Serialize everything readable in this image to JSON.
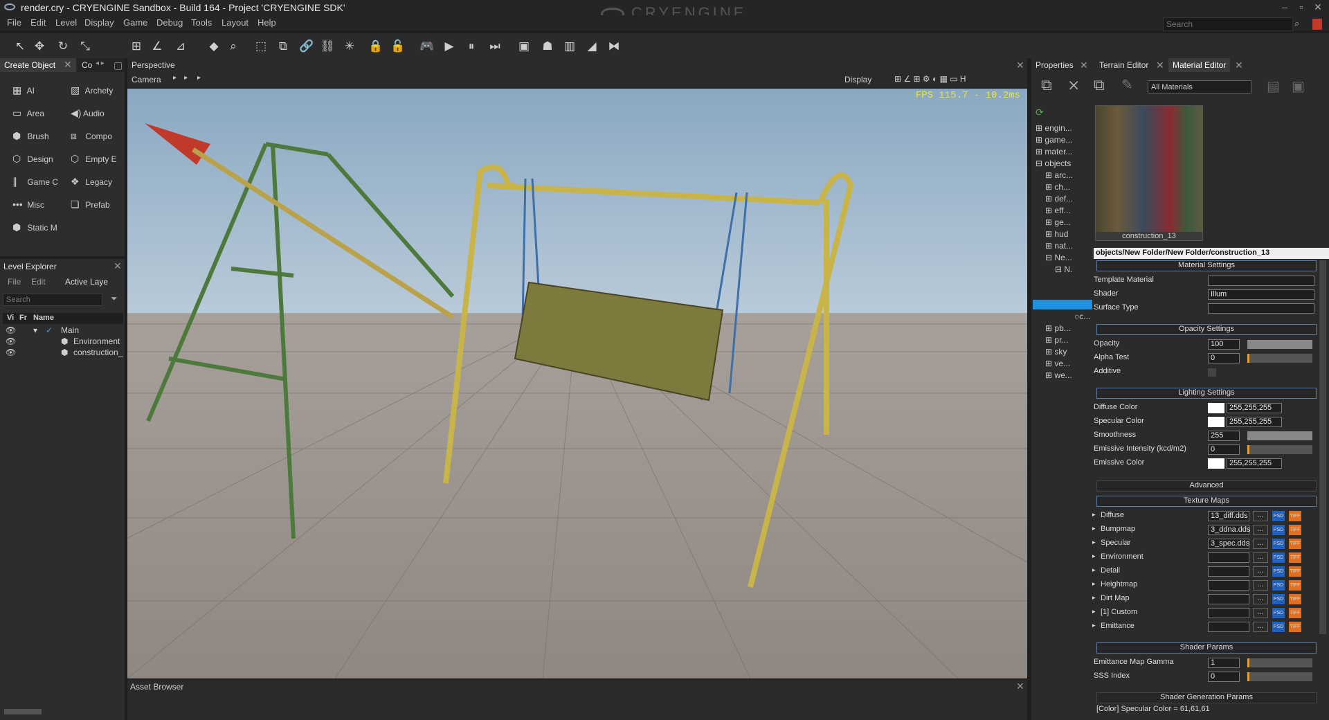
{
  "title": "render.cry - CRYENGINE Sandbox - Build 164 - Project 'CRYENGINE SDK'",
  "logo": "CRYENGINE",
  "menu": [
    "File",
    "Edit",
    "Level",
    "Display",
    "Game",
    "Debug",
    "Tools",
    "Layout",
    "Help"
  ],
  "search_placeholder": "Search",
  "create_panel": {
    "tabs": [
      "Create Object",
      "Co"
    ],
    "items": [
      {
        "icon": "ai-icon",
        "label": "AI"
      },
      {
        "icon": "archetype-icon",
        "label": "Archety"
      },
      {
        "icon": "area-icon",
        "label": "Area"
      },
      {
        "icon": "audio-icon",
        "label": "Audio"
      },
      {
        "icon": "brush-icon",
        "label": "Brush"
      },
      {
        "icon": "component-icon",
        "label": "Compo"
      },
      {
        "icon": "designer-icon",
        "label": "Design"
      },
      {
        "icon": "empty-entity-icon",
        "label": "Empty E"
      },
      {
        "icon": "game-icon",
        "label": "Game C"
      },
      {
        "icon": "legacy-icon",
        "label": "Legacy"
      },
      {
        "icon": "misc-icon",
        "label": "Misc"
      },
      {
        "icon": "prefab-icon",
        "label": "Prefab"
      },
      {
        "icon": "static-mesh-icon",
        "label": "Static M"
      }
    ]
  },
  "level_explorer": {
    "title": "Level Explorer",
    "menu": [
      "File",
      "Edit",
      "Active Laye"
    ],
    "search": "Search",
    "columns": [
      "Vi",
      "Fr",
      "Name"
    ],
    "rows": [
      "Main",
      "Environment",
      "construction_"
    ]
  },
  "viewport": {
    "tab": "Perspective",
    "camera": "Camera",
    "display": "Display",
    "fps": "FPS 115.7 - 10.2ms"
  },
  "asset_browser": "Asset Browser",
  "right_tabs": [
    "Properties",
    "Terrain Editor",
    "Material Editor"
  ],
  "material_editor": {
    "filter": "All Materials",
    "tree_top": [
      "engin...",
      "game...",
      "mater...",
      "objects"
    ],
    "tree_sub": [
      "arc...",
      "ch...",
      "def...",
      "eff...",
      "ge...",
      "hud",
      "nat...",
      "Ne...",
      "N.",
      "c...",
      "pb...",
      "pr...",
      "sky",
      "ve...",
      "we..."
    ],
    "preview_name": "construction_13",
    "path": "objects/New Folder/New Folder/construction_13",
    "material_settings": {
      "title": "Material Settings",
      "template": "Template Material",
      "shader": "Shader",
      "shader_val": "Illum",
      "surface": "Surface Type"
    },
    "opacity": {
      "title": "Opacity Settings",
      "opacity": "Opacity",
      "opacity_val": "100",
      "alpha": "Alpha Test",
      "alpha_val": "0",
      "additive": "Additive"
    },
    "lighting": {
      "title": "Lighting Settings",
      "diffuse": "Diffuse Color",
      "diffuse_val": "255,255,255",
      "specular": "Specular Color",
      "specular_val": "255,255,255",
      "smooth": "Smoothness",
      "smooth_val": "255",
      "emissive_int": "Emissive Intensity (kcd/m2)",
      "emissive_int_val": "0",
      "emissive": "Emissive Color",
      "emissive_val": "255,255,255"
    },
    "advanced": "Advanced",
    "texture_maps": {
      "title": "Texture Maps",
      "rows": [
        {
          "label": "Diffuse",
          "val": "13_diff.dds"
        },
        {
          "label": "Bumpmap",
          "val": "3_ddna.dds"
        },
        {
          "label": "Specular",
          "val": "3_spec.dds"
        },
        {
          "label": "Environment",
          "val": ""
        },
        {
          "label": "Detail",
          "val": ""
        },
        {
          "label": "Heightmap",
          "val": ""
        },
        {
          "label": "Dirt Map",
          "val": ""
        },
        {
          "label": "[1] Custom",
          "val": ""
        },
        {
          "label": "Emittance",
          "val": ""
        }
      ],
      "browse": "...",
      "psd": "PSD",
      "tiff": "TIFF"
    },
    "shader_params": {
      "title": "Shader Params",
      "gamma": "Emittance Map Gamma",
      "gamma_val": "1",
      "sss": "SSS Index",
      "sss_val": "0"
    },
    "shader_gen": "Shader Generation Params",
    "status": "[Color] Specular Color = 61,61,61"
  }
}
